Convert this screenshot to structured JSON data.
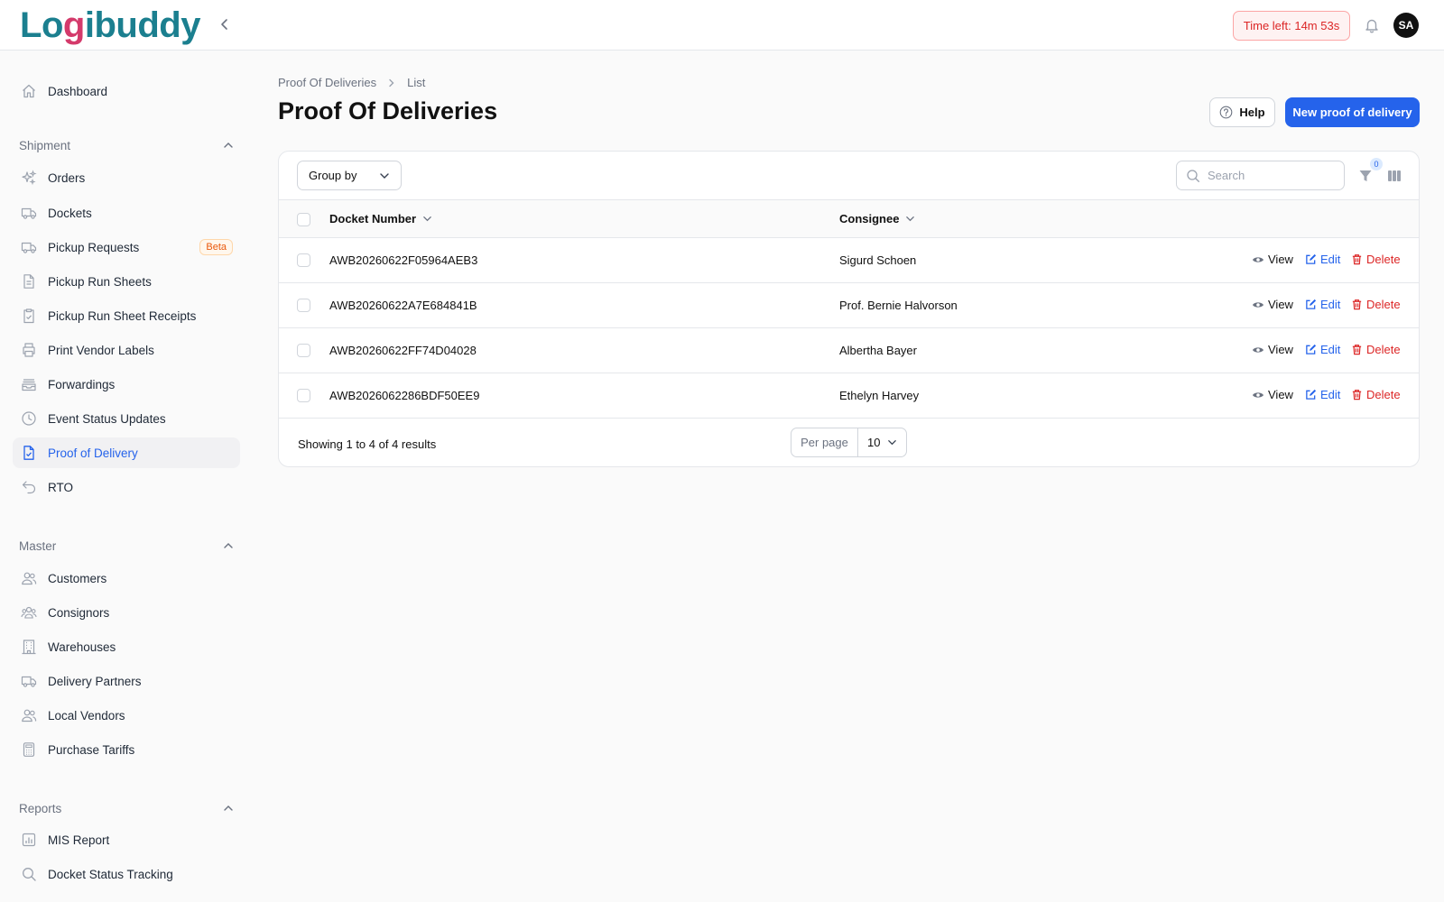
{
  "app": {
    "logo_main": "Logibuddy",
    "timer": "Time left: 14m 53s",
    "avatar_initials": "SA"
  },
  "sidebar": {
    "dashboard": "Dashboard",
    "groups": {
      "shipment": "Shipment",
      "master": "Master",
      "reports": "Reports"
    },
    "shipment_items": [
      {
        "label": "Orders",
        "icon": "sparkles-icon"
      },
      {
        "label": "Dockets",
        "icon": "truck-icon"
      },
      {
        "label": "Pickup Requests",
        "icon": "truck-icon",
        "badge": "Beta"
      },
      {
        "label": "Pickup Run Sheets",
        "icon": "document-icon"
      },
      {
        "label": "Pickup Run Sheet Receipts",
        "icon": "clipboard-check-icon"
      },
      {
        "label": "Print Vendor Labels",
        "icon": "printer-icon"
      },
      {
        "label": "Forwardings",
        "icon": "inbox-stack-icon"
      },
      {
        "label": "Event Status Updates",
        "icon": "clock-icon"
      },
      {
        "label": "Proof of Delivery",
        "icon": "document-check-icon",
        "active": true
      },
      {
        "label": "RTO",
        "icon": "return-arrow-icon"
      }
    ],
    "master_items": [
      {
        "label": "Customers",
        "icon": "users-icon"
      },
      {
        "label": "Consignors",
        "icon": "user-group-icon"
      },
      {
        "label": "Warehouses",
        "icon": "building-icon"
      },
      {
        "label": "Delivery Partners",
        "icon": "truck-icon"
      },
      {
        "label": "Local Vendors",
        "icon": "users-icon"
      },
      {
        "label": "Purchase Tariffs",
        "icon": "calculator-icon"
      }
    ],
    "report_items": [
      {
        "label": "MIS Report",
        "icon": "chart-bar-icon"
      },
      {
        "label": "Docket Status Tracking",
        "icon": "search-icon"
      }
    ]
  },
  "main": {
    "breadcrumb": [
      "Proof Of Deliveries",
      "List"
    ],
    "title": "Proof Of Deliveries",
    "help_label": "Help",
    "new_label": "New proof of delivery",
    "group_by_label": "Group by",
    "search_placeholder": "Search",
    "filter_count": "0",
    "columns": [
      "Docket Number",
      "Consignee"
    ],
    "rows": [
      {
        "docket": "AWB20260622F05964AEB3",
        "consignee": "Sigurd Schoen"
      },
      {
        "docket": "AWB20260622A7E684841B",
        "consignee": "Prof. Bernie Halvorson"
      },
      {
        "docket": "AWB20260622FF74D04028",
        "consignee": "Albertha Bayer"
      },
      {
        "docket": "AWB2026062286BDF50EE9",
        "consignee": "Ethelyn Harvey"
      }
    ],
    "actions": {
      "view": "View",
      "edit": "Edit",
      "delete": "Delete"
    },
    "footer": "Showing 1 to 4 of 4 results",
    "per_page_label": "Per page",
    "per_page_value": "10"
  },
  "colors": {
    "primary": "#2563eb",
    "danger": "#dc2626",
    "logo": "#1b7f8f",
    "logo_accent": "#d43a6b"
  }
}
